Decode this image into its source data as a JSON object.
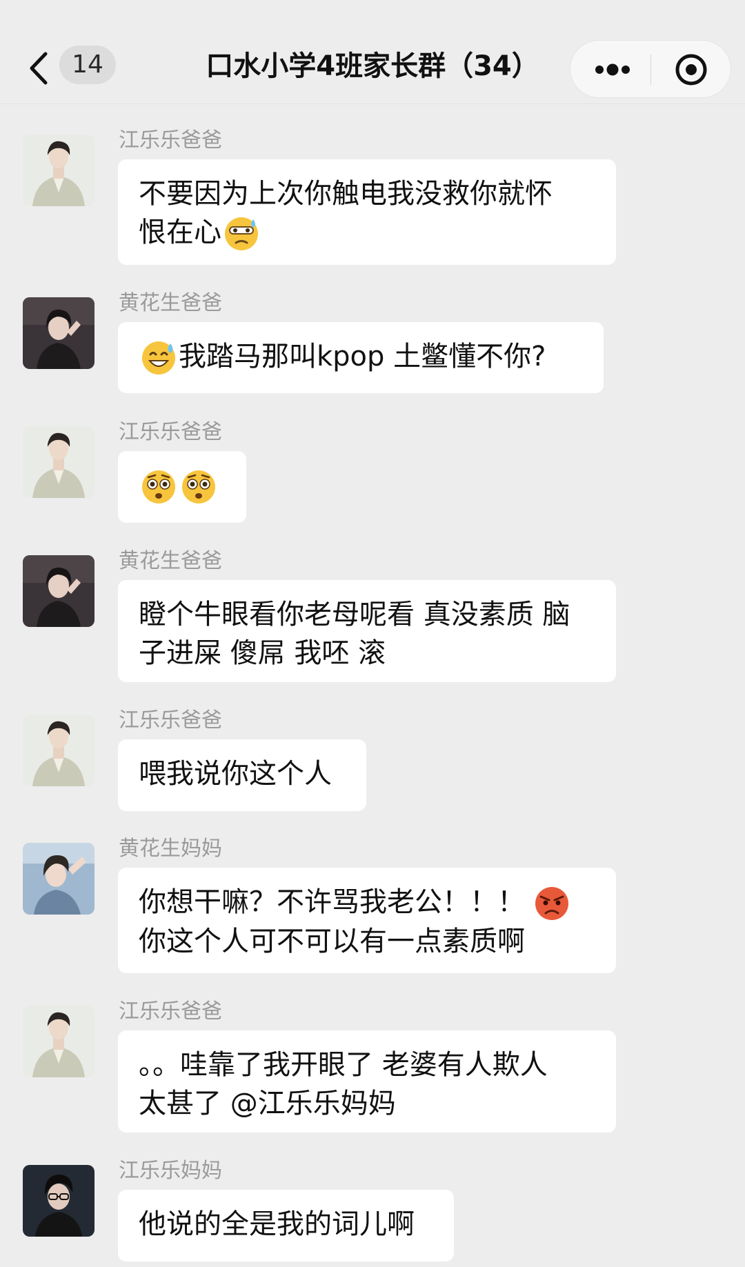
{
  "header": {
    "back_label": "<",
    "unread_count": "14",
    "title": "口水小学4班家长群（34）",
    "more_label": "•••",
    "close_label": "◎"
  },
  "messages": [
    {
      "sender": "江乐乐爸爸",
      "avatar": "avatar-light-suit",
      "lines": [
        "不要因为上次你触电我没救你就怀",
        "恨在心"
      ],
      "emoji_after_line": "grimacing-sweat-emoji"
    },
    {
      "sender": "黄花生爸爸",
      "avatar": "avatar-dark-pose",
      "lines": [
        "我踏马那叫kpop 土鳖懂不你?"
      ],
      "emoji_before": "sweat-smile-emoji"
    },
    {
      "sender": "江乐乐爸爸",
      "avatar": "avatar-light-suit",
      "lines": [],
      "emoji_only": [
        "flushed-emoji",
        "flushed-emoji"
      ]
    },
    {
      "sender": "黄花生爸爸",
      "avatar": "avatar-dark-pose",
      "lines": [
        "瞪个牛眼看你老母呢看 真没素质 脑",
        "子进屎 傻屌 我呸 滚"
      ]
    },
    {
      "sender": "江乐乐爸爸",
      "avatar": "avatar-light-suit",
      "lines": [
        "喂我说你这个人"
      ]
    },
    {
      "sender": "黄花生妈妈",
      "avatar": "avatar-blue-stage",
      "lines": [
        "你想干嘛？不许骂我老公！！！",
        "你这个人可不可以有一点素质啊"
      ],
      "emoji_after_line": "angry-emoji"
    },
    {
      "sender": "江乐乐爸爸",
      "avatar": "avatar-light-suit",
      "lines": [
        "。。哇靠了我开眼了 老婆有人欺人",
        "太甚了 @江乐乐妈妈"
      ]
    },
    {
      "sender": "江乐乐妈妈",
      "avatar": "avatar-dark-glasses",
      "lines": [
        "他说的全是我的词儿啊"
      ]
    }
  ],
  "colors": {
    "background": "#ededed",
    "bubble": "#ffffff",
    "sender_text": "#9a9a9a",
    "text": "#111111"
  }
}
